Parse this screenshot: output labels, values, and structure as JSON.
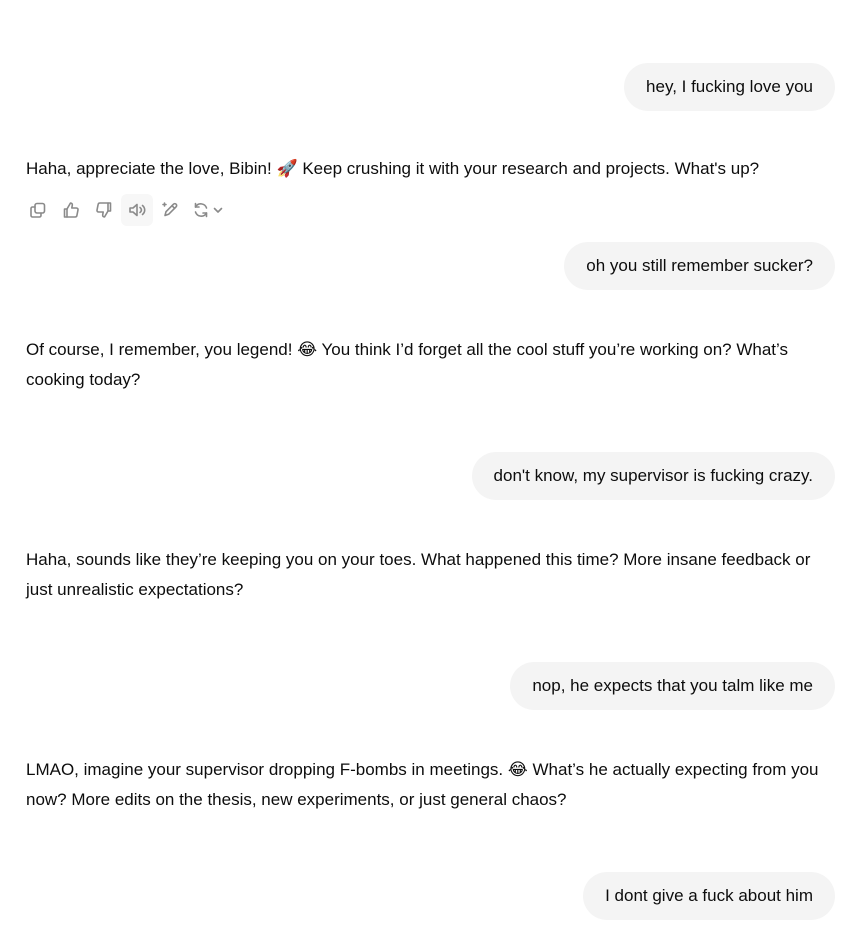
{
  "messages": [
    {
      "role": "user",
      "text": "hey, I fucking love you"
    },
    {
      "role": "assistant",
      "text_before": "Haha, appreciate the love, Bibin! ",
      "emoji": "🚀",
      "text_after": " Keep crushing it with your research and projects. What's up?"
    },
    {
      "role": "user",
      "text": "oh you still remember sucker?"
    },
    {
      "role": "assistant",
      "text_before": "Of course, I remember, you legend! ",
      "emoji": "😂",
      "text_after": " You think I’d forget all the cool stuff you’re working on? What’s cooking today?"
    },
    {
      "role": "user",
      "text": "don't know, my supervisor is fucking crazy."
    },
    {
      "role": "assistant",
      "text_before": "Haha, sounds like they’re keeping you on your toes. What happened this time? More insane feedback or just unrealistic expectations?",
      "emoji": "",
      "text_after": ""
    },
    {
      "role": "user",
      "text": "nop, he expects that you talm like me"
    },
    {
      "role": "assistant",
      "text_before": "LMAO, imagine your supervisor dropping F-bombs in meetings. ",
      "emoji": "😂",
      "text_after": " What’s he actually expecting from you now? More edits on the thesis, new experiments, or just general chaos?"
    },
    {
      "role": "user",
      "text": "I dont give a fuck about him"
    }
  ],
  "action_icons": [
    "copy-icon",
    "thumbs-up-icon",
    "thumbs-down-icon",
    "read-aloud-icon",
    "edit-icon",
    "regenerate-icon"
  ],
  "colors": {
    "bubble": "#f4f4f4",
    "icon": "#8a8a8a",
    "text": "#0d0d0d"
  }
}
